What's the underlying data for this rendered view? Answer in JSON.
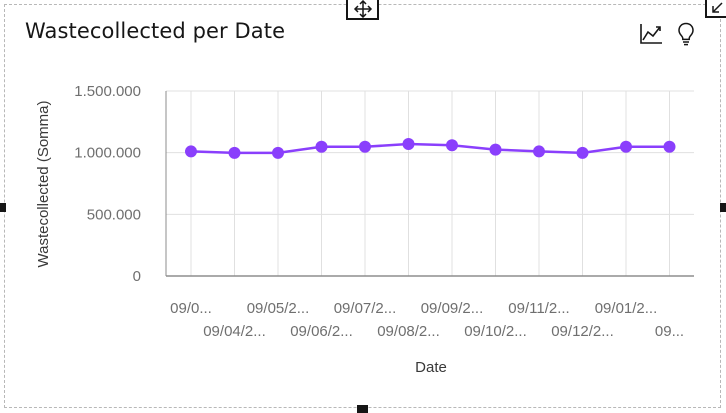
{
  "widget": {
    "title": "Wastecollected per Date",
    "toolbar": {
      "chart_type_icon": "line-chart-icon",
      "insights_icon": "lightbulb-icon"
    },
    "move_handle_icon": "move-icon",
    "corner_icon": "resize-corner-icon"
  },
  "chart_data": {
    "type": "line",
    "title": "Wastecollected per Date",
    "xlabel": "Date",
    "ylabel": "Wastecollected (Somma)",
    "ylim": [
      0,
      1500000
    ],
    "y_ticks": [
      {
        "value": 0,
        "label": "0"
      },
      {
        "value": 500000,
        "label": "500.000"
      },
      {
        "value": 1000000,
        "label": "1.000.000"
      },
      {
        "value": 1500000,
        "label": "1.500.000"
      }
    ],
    "categories": [
      "09/0...",
      "09/04/2...",
      "09/05/2...",
      "09/06/2...",
      "09/07/2...",
      "09/08/2...",
      "09/09/2...",
      "09/10/2...",
      "09/11/2...",
      "09/12/2...",
      "09/01/2...",
      "09..."
    ],
    "values": [
      1010000,
      998000,
      998000,
      1048000,
      1048000,
      1070000,
      1060000,
      1025000,
      1010000,
      998000,
      1048000,
      1048000
    ],
    "grid": true,
    "legend": "none",
    "colors": {
      "series": "#8a3ffc",
      "point": "#8a3ffc",
      "grid": "#e0e0e0",
      "axis": "#8d8d8d",
      "tick_text": "#6f6f6f"
    }
  }
}
